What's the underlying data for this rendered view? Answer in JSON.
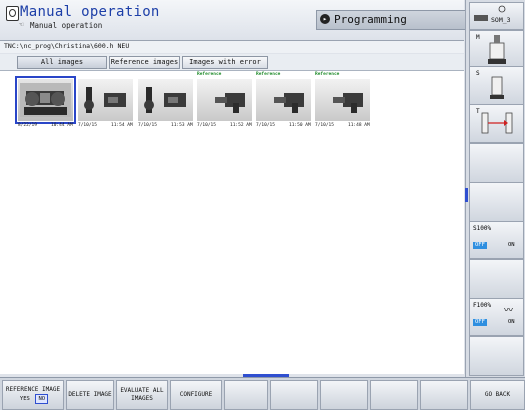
{
  "header": {
    "mode_title": "Manual operation",
    "mode_subtitle": "Manual operation",
    "programming_label": "Programming"
  },
  "path": "TNC:\\nc_prog\\Christina\\600.h NEU",
  "tabs": [
    {
      "label": "All images"
    },
    {
      "label": "Reference images"
    },
    {
      "label": "Images with error"
    }
  ],
  "images": [
    {
      "timestamp_date": "8/22/19",
      "timestamp_time": "10:44 AM",
      "reference": ""
    },
    {
      "timestamp_date": "7/10/15",
      "timestamp_time": "11:54 AM",
      "reference": ""
    },
    {
      "timestamp_date": "7/10/15",
      "timestamp_time": "11:53 AM",
      "reference": ""
    },
    {
      "timestamp_date": "7/10/15",
      "timestamp_time": "11:52 AM",
      "reference": "Reference"
    },
    {
      "timestamp_date": "7/10/15",
      "timestamp_time": "11:50 AM",
      "reference": "Reference"
    },
    {
      "timestamp_date": "7/10/15",
      "timestamp_time": "11:48 AM",
      "reference": "Reference"
    }
  ],
  "sidebar": {
    "som_label": "SOM_3",
    "m_label": "M",
    "s_label": "S",
    "t_label": "T",
    "s_override": "S100%",
    "f_override": "F100%",
    "off_label": "OFF",
    "on_label": "ON"
  },
  "softkeys": {
    "reference_image": "REFERENCE IMAGE",
    "yes": "YES",
    "no": "NO",
    "delete_image": "DELETE IMAGE",
    "evaluate_all_images": "EVALUATE ALL IMAGES",
    "configure": "CONFIGURE",
    "go_back": "GO BACK"
  },
  "colors": {
    "accent": "#2f4fd0",
    "title": "#1d3fa8",
    "reference_green": "#1f8b2a"
  }
}
